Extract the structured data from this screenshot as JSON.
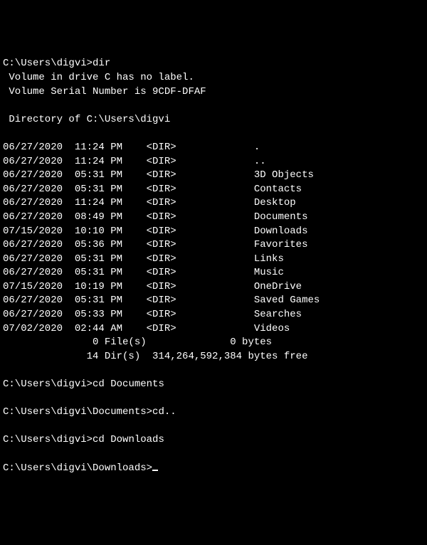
{
  "prompt1": "C:\\Users\\digvi>",
  "command1": "dir",
  "volume_line": " Volume in drive C has no label.",
  "serial_line": " Volume Serial Number is 9CDF-DFAF",
  "dir_of_line": " Directory of C:\\Users\\digvi",
  "entries": [
    {
      "date": "06/27/2020",
      "time": "11:24 PM",
      "type": "<DIR>",
      "name": "."
    },
    {
      "date": "06/27/2020",
      "time": "11:24 PM",
      "type": "<DIR>",
      "name": ".."
    },
    {
      "date": "06/27/2020",
      "time": "05:31 PM",
      "type": "<DIR>",
      "name": "3D Objects"
    },
    {
      "date": "06/27/2020",
      "time": "05:31 PM",
      "type": "<DIR>",
      "name": "Contacts"
    },
    {
      "date": "06/27/2020",
      "time": "11:24 PM",
      "type": "<DIR>",
      "name": "Desktop"
    },
    {
      "date": "06/27/2020",
      "time": "08:49 PM",
      "type": "<DIR>",
      "name": "Documents"
    },
    {
      "date": "07/15/2020",
      "time": "10:10 PM",
      "type": "<DIR>",
      "name": "Downloads"
    },
    {
      "date": "06/27/2020",
      "time": "05:36 PM",
      "type": "<DIR>",
      "name": "Favorites"
    },
    {
      "date": "06/27/2020",
      "time": "05:31 PM",
      "type": "<DIR>",
      "name": "Links"
    },
    {
      "date": "06/27/2020",
      "time": "05:31 PM",
      "type": "<DIR>",
      "name": "Music"
    },
    {
      "date": "07/15/2020",
      "time": "10:19 PM",
      "type": "<DIR>",
      "name": "OneDrive"
    },
    {
      "date": "06/27/2020",
      "time": "05:31 PM",
      "type": "<DIR>",
      "name": "Saved Games"
    },
    {
      "date": "06/27/2020",
      "time": "05:33 PM",
      "type": "<DIR>",
      "name": "Searches"
    },
    {
      "date": "07/02/2020",
      "time": "02:44 AM",
      "type": "<DIR>",
      "name": "Videos"
    }
  ],
  "files_summary": "               0 File(s)              0 bytes",
  "dirs_summary": "              14 Dir(s)  314,264,592,384 bytes free",
  "prompt2": "C:\\Users\\digvi>",
  "command2": "cd Documents",
  "prompt3": "C:\\Users\\digvi\\Documents>",
  "command3": "cd..",
  "prompt4": "C:\\Users\\digvi>",
  "command4": "cd Downloads",
  "prompt5": "C:\\Users\\digvi\\Downloads>"
}
